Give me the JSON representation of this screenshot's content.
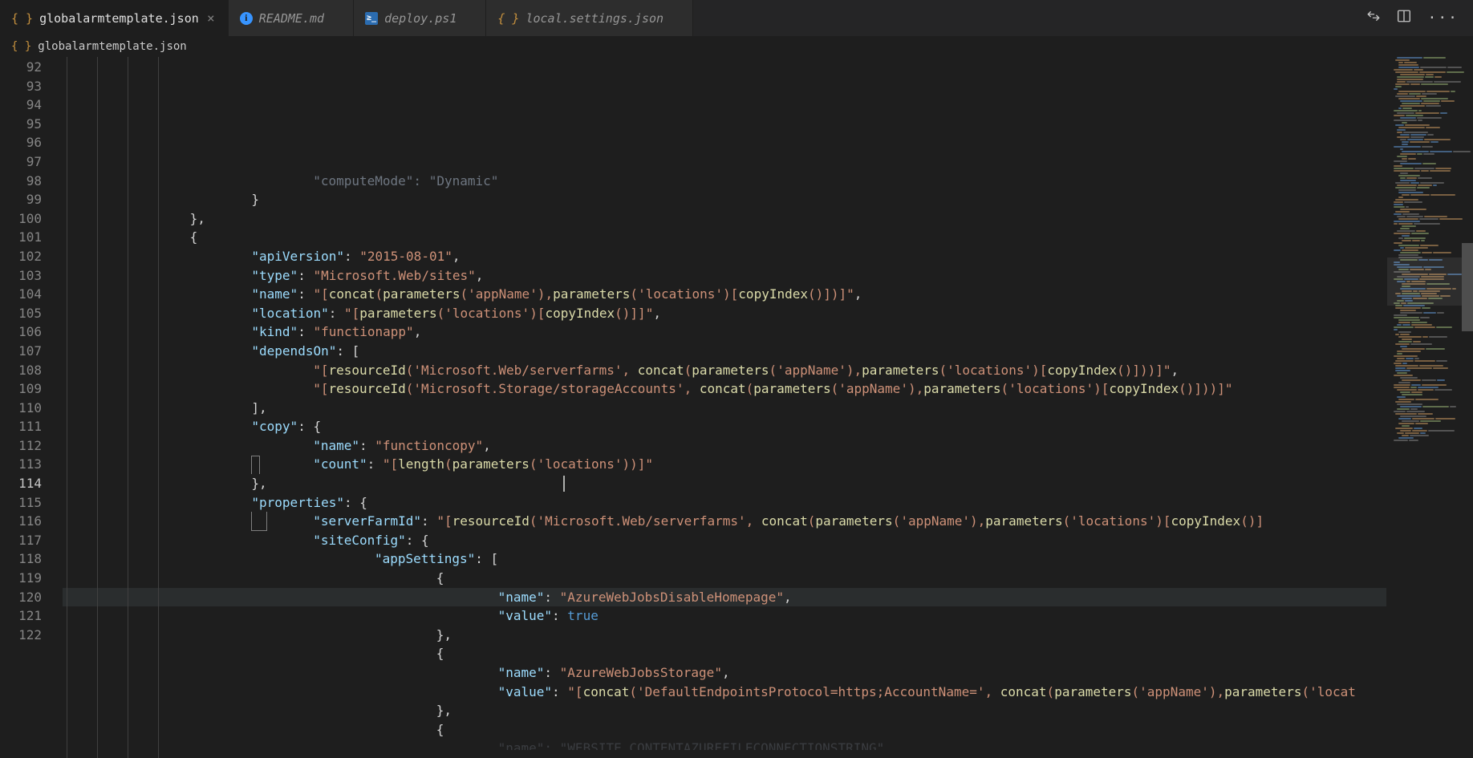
{
  "tabs": [
    {
      "label": "globalarmtemplate.json",
      "iconType": "json",
      "active": true,
      "italic": false
    },
    {
      "label": "README.md",
      "iconType": "info",
      "active": false,
      "italic": true
    },
    {
      "label": "deploy.ps1",
      "iconType": "ps",
      "active": false,
      "italic": true
    },
    {
      "label": "local.settings.json",
      "iconType": "json",
      "active": false,
      "italic": true
    }
  ],
  "breadcrumb": {
    "file": "globalarmtemplate.json"
  },
  "gutter": {
    "start": 92,
    "end": 122
  },
  "code": {
    "lines": [
      {
        "n": 92,
        "indent": 8,
        "tokens": [
          [
            "k",
            "\"computeMode\""
          ],
          [
            "p",
            ": "
          ],
          [
            "s",
            "\"Dynamic\""
          ]
        ],
        "dim": true
      },
      {
        "n": 93,
        "indent": 6,
        "tokens": [
          [
            "p",
            "}"
          ]
        ]
      },
      {
        "n": 94,
        "indent": 4,
        "tokens": [
          [
            "p",
            "},"
          ]
        ]
      },
      {
        "n": 95,
        "indent": 4,
        "tokens": [
          [
            "p",
            "{"
          ]
        ]
      },
      {
        "n": 96,
        "indent": 6,
        "tokens": [
          [
            "k",
            "\"apiVersion\""
          ],
          [
            "p",
            ": "
          ],
          [
            "s",
            "\"2015-08-01\""
          ],
          [
            "p",
            ","
          ]
        ]
      },
      {
        "n": 97,
        "indent": 6,
        "tokens": [
          [
            "k",
            "\"type\""
          ],
          [
            "p",
            ": "
          ],
          [
            "s",
            "\"Microsoft.Web/sites\""
          ],
          [
            "p",
            ","
          ]
        ]
      },
      {
        "n": 98,
        "indent": 6,
        "tokens": [
          [
            "k",
            "\"name\""
          ],
          [
            "p",
            ": "
          ],
          [
            "s",
            "\"["
          ],
          [
            "f",
            "concat"
          ],
          [
            "s",
            "("
          ],
          [
            "f",
            "parameters"
          ],
          [
            "s",
            "("
          ],
          [
            "s",
            "'appName'"
          ],
          [
            "s",
            "),"
          ],
          [
            "f",
            "parameters"
          ],
          [
            "s",
            "("
          ],
          [
            "s",
            "'locations'"
          ],
          [
            "s",
            ")["
          ],
          [
            "f",
            "copyIndex"
          ],
          [
            "s",
            "()"
          ],
          [
            "s",
            "])]\""
          ],
          [
            "p",
            ","
          ]
        ]
      },
      {
        "n": 99,
        "indent": 6,
        "tokens": [
          [
            "k",
            "\"location\""
          ],
          [
            "p",
            ": "
          ],
          [
            "s",
            "\"["
          ],
          [
            "f",
            "parameters"
          ],
          [
            "s",
            "("
          ],
          [
            "s",
            "'locations'"
          ],
          [
            "s",
            ")["
          ],
          [
            "f",
            "copyIndex"
          ],
          [
            "s",
            "()"
          ],
          [
            "s",
            "]]\""
          ],
          [
            "p",
            ","
          ]
        ]
      },
      {
        "n": 100,
        "indent": 6,
        "tokens": [
          [
            "k",
            "\"kind\""
          ],
          [
            "p",
            ": "
          ],
          [
            "s",
            "\"functionapp\""
          ],
          [
            "p",
            ","
          ]
        ]
      },
      {
        "n": 101,
        "indent": 6,
        "tokens": [
          [
            "k",
            "\"dependsOn\""
          ],
          [
            "p",
            ": ["
          ]
        ]
      },
      {
        "n": 102,
        "indent": 8,
        "tokens": [
          [
            "s",
            "\"["
          ],
          [
            "f",
            "resourceId"
          ],
          [
            "s",
            "("
          ],
          [
            "s",
            "'Microsoft.Web/serverfarms'"
          ],
          [
            "s",
            ", "
          ],
          [
            "f",
            "concat"
          ],
          [
            "s",
            "("
          ],
          [
            "f",
            "parameters"
          ],
          [
            "s",
            "("
          ],
          [
            "s",
            "'appName'"
          ],
          [
            "s",
            "),"
          ],
          [
            "f",
            "parameters"
          ],
          [
            "s",
            "("
          ],
          [
            "s",
            "'locations'"
          ],
          [
            "s",
            ")["
          ],
          [
            "f",
            "copyIndex"
          ],
          [
            "s",
            "()"
          ],
          [
            "s",
            "]))]\""
          ],
          [
            "p",
            ","
          ]
        ]
      },
      {
        "n": 103,
        "indent": 8,
        "tokens": [
          [
            "s",
            "\"["
          ],
          [
            "f",
            "resourceId"
          ],
          [
            "s",
            "("
          ],
          [
            "s",
            "'Microsoft.Storage/storageAccounts'"
          ],
          [
            "s",
            ", "
          ],
          [
            "f",
            "concat"
          ],
          [
            "s",
            "("
          ],
          [
            "f",
            "parameters"
          ],
          [
            "s",
            "("
          ],
          [
            "s",
            "'appName'"
          ],
          [
            "s",
            "),"
          ],
          [
            "f",
            "parameters"
          ],
          [
            "s",
            "("
          ],
          [
            "s",
            "'locations'"
          ],
          [
            "s",
            ")["
          ],
          [
            "f",
            "copyIndex"
          ],
          [
            "s",
            "()"
          ],
          [
            "s",
            "]))]\""
          ]
        ]
      },
      {
        "n": 104,
        "indent": 6,
        "tokens": [
          [
            "p",
            "],"
          ]
        ]
      },
      {
        "n": 105,
        "indent": 6,
        "tokens": [
          [
            "k",
            "\"copy\""
          ],
          [
            "p",
            ": {"
          ]
        ]
      },
      {
        "n": 106,
        "indent": 8,
        "tokens": [
          [
            "k",
            "\"name\""
          ],
          [
            "p",
            ": "
          ],
          [
            "s",
            "\"functioncopy\""
          ],
          [
            "p",
            ","
          ]
        ]
      },
      {
        "n": 107,
        "indent": 8,
        "tokens": [
          [
            "k",
            "\"count\""
          ],
          [
            "p",
            ": "
          ],
          [
            "s",
            "\"["
          ],
          [
            "f",
            "length"
          ],
          [
            "s",
            "("
          ],
          [
            "f",
            "parameters"
          ],
          [
            "s",
            "("
          ],
          [
            "s",
            "'locations'"
          ],
          [
            "s",
            "))]\""
          ]
        ]
      },
      {
        "n": 108,
        "indent": 6,
        "tokens": [
          [
            "p",
            "},"
          ]
        ]
      },
      {
        "n": 109,
        "indent": 6,
        "tokens": [
          [
            "k",
            "\"properties\""
          ],
          [
            "p",
            ": {"
          ]
        ]
      },
      {
        "n": 110,
        "indent": 8,
        "tokens": [
          [
            "k",
            "\"serverFarmId\""
          ],
          [
            "p",
            ": "
          ],
          [
            "s",
            "\"["
          ],
          [
            "f",
            "resourceId"
          ],
          [
            "s",
            "("
          ],
          [
            "s",
            "'Microsoft.Web/serverfarms'"
          ],
          [
            "s",
            ", "
          ],
          [
            "f",
            "concat"
          ],
          [
            "s",
            "("
          ],
          [
            "f",
            "parameters"
          ],
          [
            "s",
            "("
          ],
          [
            "s",
            "'appName'"
          ],
          [
            "s",
            "),"
          ],
          [
            "f",
            "parameters"
          ],
          [
            "s",
            "("
          ],
          [
            "s",
            "'locations'"
          ],
          [
            "s",
            ")["
          ],
          [
            "f",
            "copyIndex"
          ],
          [
            "s",
            "()"
          ],
          [
            "s",
            "]"
          ]
        ]
      },
      {
        "n": 111,
        "indent": 8,
        "tokens": [
          [
            "k",
            "\"siteConfig\""
          ],
          [
            "p",
            ": {"
          ]
        ]
      },
      {
        "n": 112,
        "indent": 10,
        "tokens": [
          [
            "k",
            "\"appSettings\""
          ],
          [
            "p",
            ": ["
          ]
        ]
      },
      {
        "n": 113,
        "indent": 12,
        "tokens": [
          [
            "p",
            "{"
          ]
        ],
        "selTop": true
      },
      {
        "n": 114,
        "indent": 14,
        "tokens": [
          [
            "k",
            "\"name\""
          ],
          [
            "p",
            ": "
          ],
          [
            "s",
            "\"AzureWebJobsDisableHomepage\""
          ],
          [
            "p",
            ","
          ]
        ],
        "hl": true,
        "cursorAt": 624
      },
      {
        "n": 115,
        "indent": 14,
        "tokens": [
          [
            "k",
            "\"value\""
          ],
          [
            "p",
            ": "
          ],
          [
            "kw",
            "true"
          ]
        ]
      },
      {
        "n": 116,
        "indent": 12,
        "tokens": [
          [
            "p",
            "},"
          ]
        ],
        "selBot": true
      },
      {
        "n": 117,
        "indent": 12,
        "tokens": [
          [
            "p",
            "{"
          ]
        ]
      },
      {
        "n": 118,
        "indent": 14,
        "tokens": [
          [
            "k",
            "\"name\""
          ],
          [
            "p",
            ": "
          ],
          [
            "s",
            "\"AzureWebJobsStorage\""
          ],
          [
            "p",
            ","
          ]
        ]
      },
      {
        "n": 119,
        "indent": 14,
        "tokens": [
          [
            "k",
            "\"value\""
          ],
          [
            "p",
            ": "
          ],
          [
            "s",
            "\"["
          ],
          [
            "f",
            "concat"
          ],
          [
            "s",
            "("
          ],
          [
            "s",
            "'DefaultEndpointsProtocol=https;AccountName='"
          ],
          [
            "s",
            ", "
          ],
          [
            "f",
            "concat"
          ],
          [
            "s",
            "("
          ],
          [
            "f",
            "parameters"
          ],
          [
            "s",
            "("
          ],
          [
            "s",
            "'appName'"
          ],
          [
            "s",
            "),"
          ],
          [
            "f",
            "parameters"
          ],
          [
            "s",
            "("
          ],
          [
            "s",
            "'locat"
          ]
        ]
      },
      {
        "n": 120,
        "indent": 12,
        "tokens": [
          [
            "p",
            "},"
          ]
        ]
      },
      {
        "n": 121,
        "indent": 12,
        "tokens": [
          [
            "p",
            "{"
          ]
        ]
      },
      {
        "n": 122,
        "indent": 14,
        "tokens": [
          [
            "k",
            "\"name\""
          ],
          [
            "p",
            ": "
          ],
          [
            "s",
            "\"WEBSITE_CONTENTAZUREFILECONNECTIONSTRING\""
          ]
        ],
        "dim": true,
        "partial": true
      }
    ]
  },
  "titlebarActions": {
    "compare": "⇄",
    "split": "▢▢",
    "more": "···"
  }
}
